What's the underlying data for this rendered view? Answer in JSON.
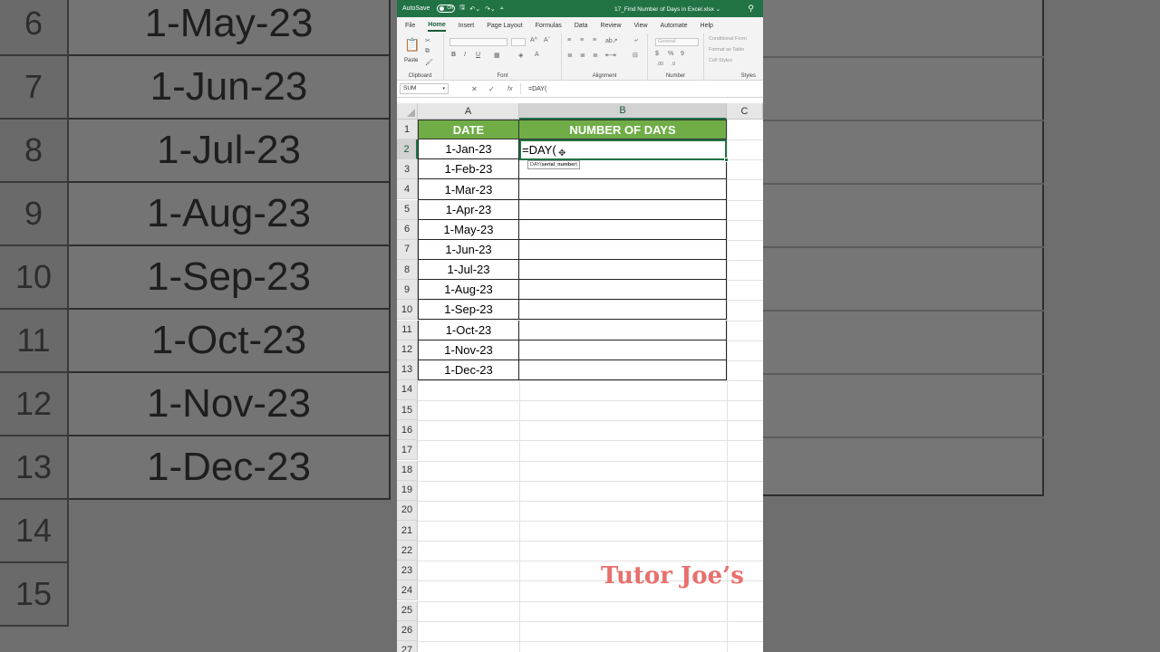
{
  "background": {
    "rows": [
      {
        "num": "6",
        "date": "1-May-23"
      },
      {
        "num": "7",
        "date": "1-Jun-23"
      },
      {
        "num": "8",
        "date": "1-Jul-23"
      },
      {
        "num": "9",
        "date": "1-Aug-23"
      },
      {
        "num": "10",
        "date": "1-Sep-23"
      },
      {
        "num": "11",
        "date": "1-Oct-23"
      },
      {
        "num": "12",
        "date": "1-Nov-23"
      },
      {
        "num": "13",
        "date": "1-Dec-23"
      },
      {
        "num": "14",
        "date": ""
      },
      {
        "num": "15",
        "date": ""
      }
    ]
  },
  "titlebar": {
    "autosave_label": "AutoSave",
    "autosave_state": "Off",
    "filename": "17_Find Number of Days in Excel.xlsx ⌄"
  },
  "menu": [
    "File",
    "Home",
    "Insert",
    "Page Layout",
    "Formulas",
    "Data",
    "Review",
    "View",
    "Automate",
    "Help"
  ],
  "menu_active": "Home",
  "ribbon": {
    "clipboard": "Clipboard",
    "paste": "Paste",
    "font": "Font",
    "alignment": "Alignment",
    "number": "Number",
    "number_format": "General",
    "styles": "Styles",
    "conditional": "Conditional Form",
    "format_table": "Format as Table",
    "cell_styles": "Cell Styles"
  },
  "formula_bar": {
    "name_box": "SUM",
    "fx": "fx",
    "formula": "=DAY("
  },
  "sheet": {
    "columns": [
      "A",
      "B",
      "C"
    ],
    "header_a": "DATE",
    "header_b": "NUMBER OF DAYS",
    "row_numbers": [
      "1",
      "2",
      "3",
      "4",
      "5",
      "6",
      "7",
      "8",
      "9",
      "10",
      "11",
      "12",
      "13",
      "14",
      "15",
      "16",
      "17",
      "18",
      "19",
      "20",
      "21",
      "22",
      "23",
      "24",
      "25",
      "26",
      "27"
    ],
    "dates": [
      "1-Jan-23",
      "1-Feb-23",
      "1-Mar-23",
      "1-Apr-23",
      "1-May-23",
      "1-Jun-23",
      "1-Jul-23",
      "1-Aug-23",
      "1-Sep-23",
      "1-Oct-23",
      "1-Nov-23",
      "1-Dec-23"
    ],
    "active_cell_text": "=DAY(",
    "tooltip_func": "DAY(",
    "tooltip_arg": "serial_number",
    "tooltip_end": ")"
  },
  "watermark": "Tutor Joe’s",
  "colors": {
    "excel_green": "#217346",
    "header_fill": "#70ad47",
    "watermark": "#e8706c"
  }
}
